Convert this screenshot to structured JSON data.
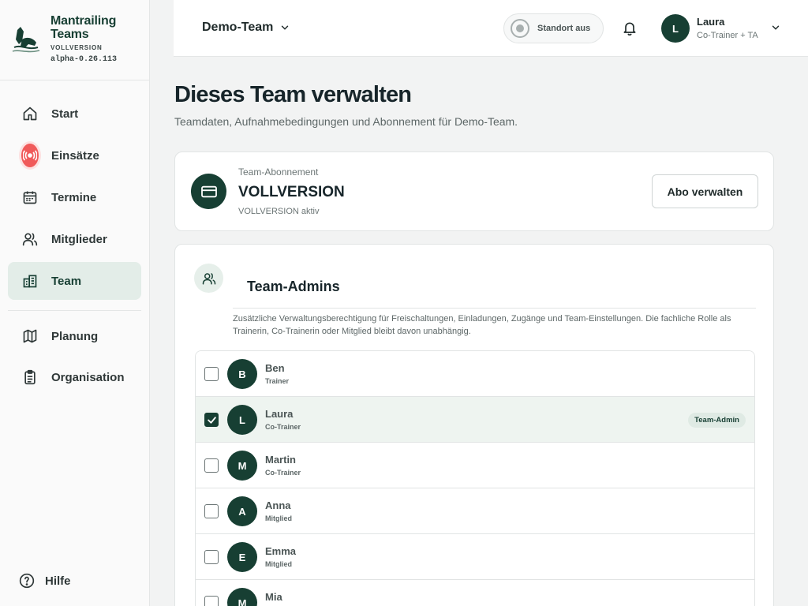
{
  "brand": {
    "name_line1": "Mantrailing",
    "name_line2": "Teams",
    "edition": "VOLLVERSION",
    "version": "alpha-0.26.113"
  },
  "sidebar": {
    "items": [
      {
        "label": "Start",
        "icon": "home-icon"
      },
      {
        "label": "Einsätze",
        "icon": "alarm-icon"
      },
      {
        "label": "Termine",
        "icon": "calendar-icon"
      },
      {
        "label": "Mitglieder",
        "icon": "users-icon"
      },
      {
        "label": "Team",
        "icon": "building-icon",
        "active": true
      },
      {
        "label": "Planung",
        "icon": "map-icon"
      },
      {
        "label": "Organisation",
        "icon": "clipboard-icon"
      }
    ],
    "help_label": "Hilfe"
  },
  "header": {
    "team": "Demo-Team",
    "location_label": "Standort aus",
    "user": {
      "initial": "L",
      "name": "Laura",
      "role": "Co-Trainer + TA"
    }
  },
  "page": {
    "title": "Dieses Team verwalten",
    "subtitle": "Teamdaten, Aufnahmebedingungen und Abonnement für Demo-Team."
  },
  "subscription": {
    "kicker": "Team-Abonnement",
    "plan": "VOLLVERSION",
    "status": "VOLLVERSION aktiv",
    "button": "Abo verwalten"
  },
  "admins": {
    "title": "Team-Admins",
    "description": "Zusätzliche Verwaltungsberechtigung für Freischaltungen, Einladungen, Zugänge und Team-Einstellungen. Die fachliche Rolle als Trainerin, Co-Trainerin oder Mitglied bleibt davon unabhängig.",
    "members": [
      {
        "initial": "B",
        "name": "Ben",
        "role": "Trainer",
        "checked": false,
        "badge": ""
      },
      {
        "initial": "L",
        "name": "Laura",
        "role": "Co-Trainer",
        "checked": true,
        "badge": "Team-Admin"
      },
      {
        "initial": "M",
        "name": "Martin",
        "role": "Co-Trainer",
        "checked": false,
        "badge": ""
      },
      {
        "initial": "A",
        "name": "Anna",
        "role": "Mitglied",
        "checked": false,
        "badge": ""
      },
      {
        "initial": "E",
        "name": "Emma",
        "role": "Mitglied",
        "checked": false,
        "badge": ""
      },
      {
        "initial": "M",
        "name": "Mia",
        "role": "",
        "checked": false,
        "badge": ""
      }
    ]
  },
  "colors": {
    "accent": "#173f33",
    "alarm": "#f05a5a",
    "active_bg": "#e3ede8"
  }
}
